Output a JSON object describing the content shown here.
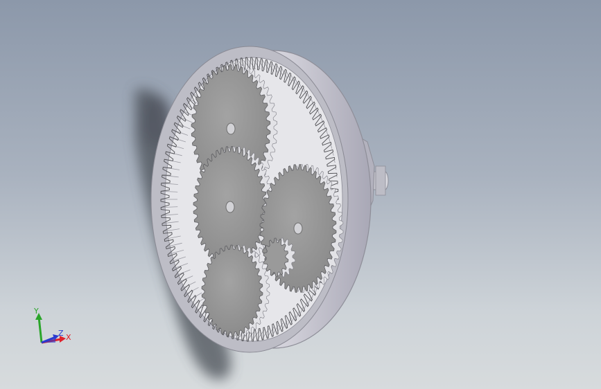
{
  "viewport": {
    "background_top": "#8c98aa",
    "background_bottom": "#d7dbdd"
  },
  "model": {
    "part_color": "#c9c9ce",
    "tooth_color": "#e2e2e6",
    "shadow_color": "#4a4f57"
  },
  "triad": {
    "x_label": "X",
    "y_label": "Y",
    "z_label": "Z",
    "x_color": "#e0202a",
    "y_color": "#2aa52a",
    "z_color": "#2a3ad0"
  }
}
